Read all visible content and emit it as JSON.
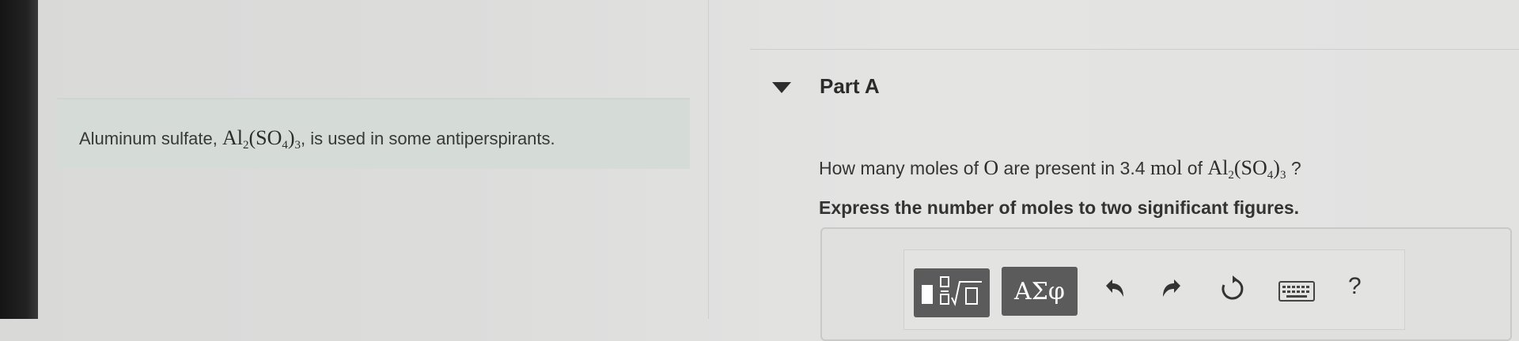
{
  "problem": {
    "text_before": "Aluminum sulfate, ",
    "formula": {
      "el1": "Al",
      "n1": "2",
      "grp": "(SO",
      "n2": "4",
      ")": ")",
      "n3": "3"
    },
    "text_after": ", is used in some antiperspirants."
  },
  "part": {
    "title": "Part A",
    "question_before": "How many moles of ",
    "question_symbol": "O",
    "question_mid": " are present in 3.4 ",
    "question_unit": "mol",
    "question_of": " of ",
    "question_end": " ?",
    "instruction": "Express the number of moles to two significant figures."
  },
  "toolbar": {
    "templates_icon": "templates-icon",
    "greek_label": "ΑΣφ",
    "undo_icon": "undo-icon",
    "redo_icon": "redo-icon",
    "reset_icon": "reset-icon",
    "keyboard_icon": "keyboard-icon",
    "help_label": "?"
  }
}
